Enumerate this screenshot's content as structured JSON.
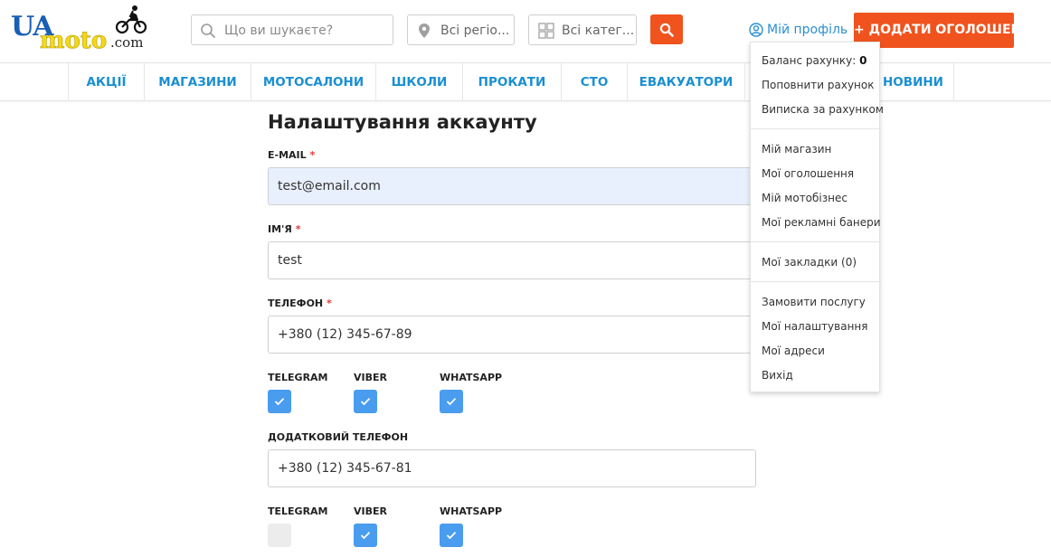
{
  "logo": {
    "ua": "UA",
    "moto": "moto",
    "dotcom": ".com"
  },
  "header": {
    "search_placeholder": "Що ви шукаєте?",
    "region_placeholder": "Всі регіо...",
    "category_placeholder": "Всі катег...",
    "profile_label": "Мій профіль",
    "add_button_label": "+ ДОДАТИ ОГОЛОШЕННЯ"
  },
  "nav": {
    "items": [
      "АКЦІЇ",
      "МАГАЗИНИ",
      "МОТОСАЛОНИ",
      "ШКОЛИ",
      "ПРОКАТИ",
      "СТО",
      "ЕВАКУАТОРИ",
      "",
      "НОВИНИ"
    ]
  },
  "main": {
    "title": "Налаштування аккаунту",
    "email": {
      "label": "E-MAIL",
      "required": "*",
      "value": "test@email.com"
    },
    "name": {
      "label": "ІМ'Я",
      "required": "*",
      "value": "test"
    },
    "phone": {
      "label": "ТЕЛЕФОН",
      "required": "*",
      "value": "+380 (12) 345-67-89"
    },
    "phone_messengers": [
      {
        "label": "TELEGRAM",
        "checked": true
      },
      {
        "label": "VIBER",
        "checked": true
      },
      {
        "label": "WHATSAPP",
        "checked": true
      }
    ],
    "extra_phone": {
      "label": "ДОДАТКОВИЙ ТЕЛЕФОН",
      "value": "+380 (12) 345-67-81"
    },
    "extra_messengers": [
      {
        "label": "TELEGRAM",
        "checked": false
      },
      {
        "label": "VIBER",
        "checked": true
      },
      {
        "label": "WHATSAPP",
        "checked": true
      }
    ]
  },
  "dropdown": {
    "balance_label": "Баланс рахунку:",
    "balance_value": "0",
    "top_up": "Поповнити рахунок",
    "statement": "Виписка за рахунком",
    "my_shop": "Мій магазин",
    "my_ads": "Мої оголошення",
    "my_business": "Мій мотобізнес",
    "my_banners": "Мої рекламні банери",
    "bookmarks": "Мої закладки (0)",
    "order_service": "Замовити послугу",
    "settings": "Мої налаштування",
    "addresses": "Мої адреси",
    "logout": "Вихід"
  },
  "colors": {
    "accent_orange": "#f0531e",
    "link_blue": "#2a8fd1",
    "checkbox_blue": "#4a9cef",
    "autofill_bg": "#e8f0fd"
  }
}
